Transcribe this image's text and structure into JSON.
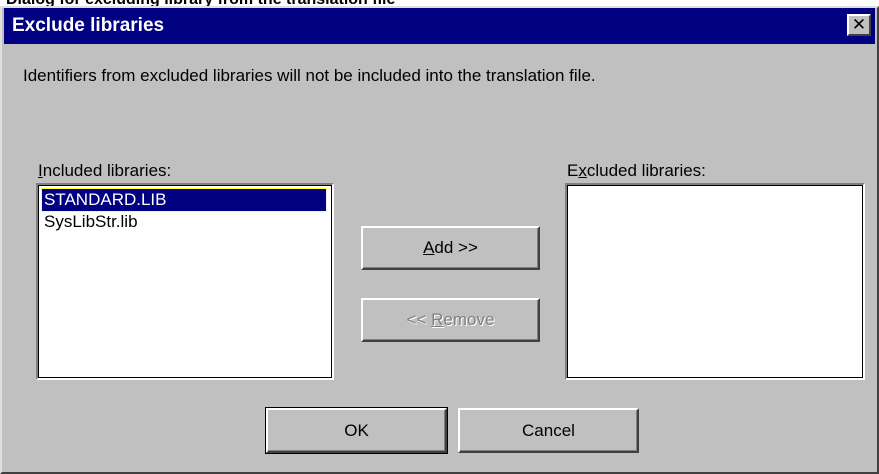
{
  "caption_strip": "Dialog for excluding library from the translation file",
  "dialog": {
    "title": "Exclude libraries",
    "close_glyph": "✕",
    "description": "Identifiers from excluded libraries will not be included into the translation file."
  },
  "included": {
    "label": "Included libraries:",
    "items": [
      {
        "label": "STANDARD.LIB",
        "selected": true
      },
      {
        "label": "SysLibStr.lib",
        "selected": false
      }
    ]
  },
  "excluded": {
    "label": "Excluded libraries:",
    "items": []
  },
  "buttons": {
    "add": {
      "mnemonic": "A",
      "rest": "dd >>",
      "enabled": true
    },
    "remove": {
      "prefix": "<< ",
      "mnemonic": "R",
      "rest": "emove",
      "enabled": false
    },
    "ok": "OK",
    "cancel": "Cancel"
  },
  "colors": {
    "face": "#c0c0c0",
    "titlebar": "#000080",
    "selection": "#000080"
  },
  "icons": {
    "close": "close-icon"
  }
}
